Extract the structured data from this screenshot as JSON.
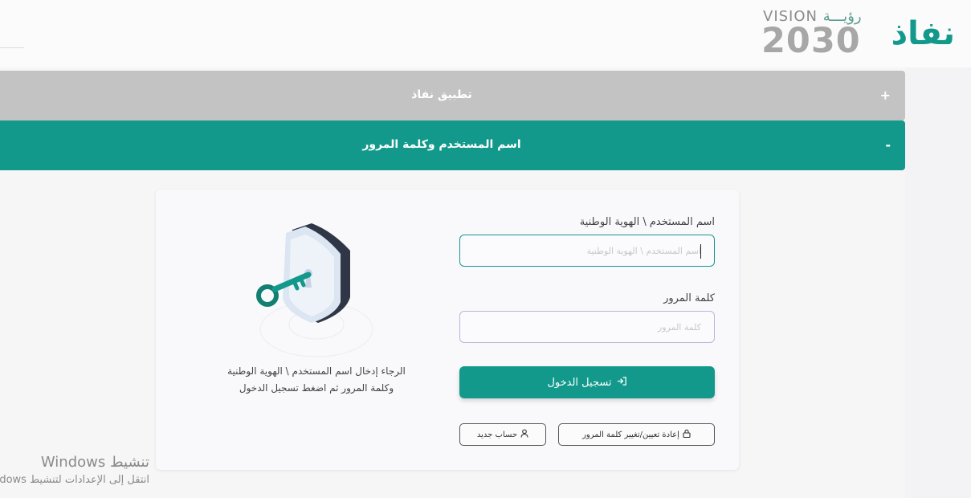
{
  "header": {
    "brand": "نفاذ",
    "vision_word": "VISION",
    "vision_arabic": "رؤيـــة",
    "vision_year": "2030"
  },
  "accordion": [
    {
      "title": "تطبيق نفاذ",
      "sign": "+"
    },
    {
      "title": "اسم المستخدم وكلمة المرور",
      "sign": "-"
    }
  ],
  "form": {
    "username_label": "اسم المستخدم \\ الهوية الوطنية",
    "username_placeholder": "اسم المستخدم \\ الهوية الوطنية",
    "username_value": "",
    "password_label": "كلمة المرور",
    "password_placeholder": "كلمة المرور",
    "password_value": "",
    "login_button": "تسجيل الدخول",
    "reset_button": "إعادة تعيين/تغيير كلمة المرور",
    "new_account_button": "حساب جديد"
  },
  "hint": {
    "line1": "الرجاء إدخال اسم المستخدم \\ الهوية الوطنية",
    "line2": "وكلمة المرور ثم اضغط تسجيل الدخول"
  },
  "watermark": {
    "line1": "تنشيط Windows",
    "line2": "انتقل إلى الإعدادات لتنشيط Windows"
  },
  "icons": {
    "login": "login-arrow-icon",
    "lock": "lock-icon",
    "user": "user-icon"
  },
  "colors": {
    "primary": "#13998c",
    "accordion_inactive": "#c3c3c3"
  }
}
